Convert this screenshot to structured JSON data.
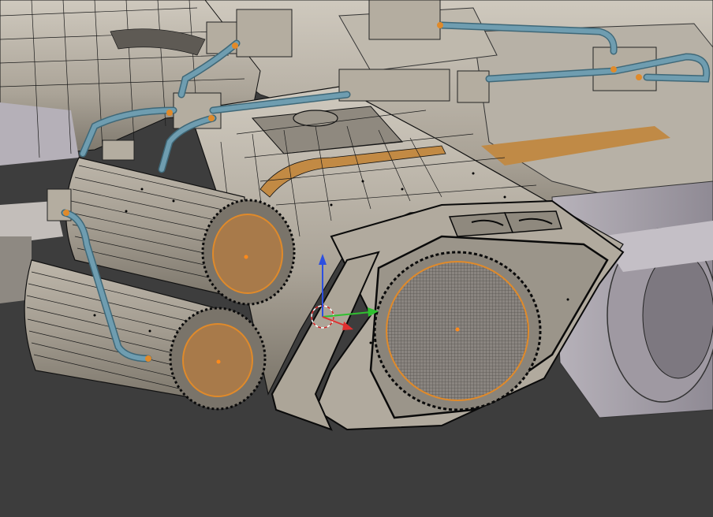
{
  "viewport": {
    "background": "#3d3d3d",
    "mode": "edit-mode-wireframe-overlay"
  },
  "colors": {
    "hull": "#a9a296",
    "hull_light": "#c9c3b8",
    "hull_dark": "#6d675e",
    "edge": "#111111",
    "selected_face": "#a87a4a",
    "selected_edge": "#e08a2a",
    "pipe": "#6f9db0",
    "pipe_dark": "#3f6878",
    "gizmo_x": "#e03030",
    "gizmo_y": "#30c030",
    "gizmo_z": "#2c4fe0",
    "cursor": "#ffffff"
  },
  "icons": {
    "cursor": "3d-cursor-icon",
    "gizmo": "transform-gizmo-icon"
  }
}
